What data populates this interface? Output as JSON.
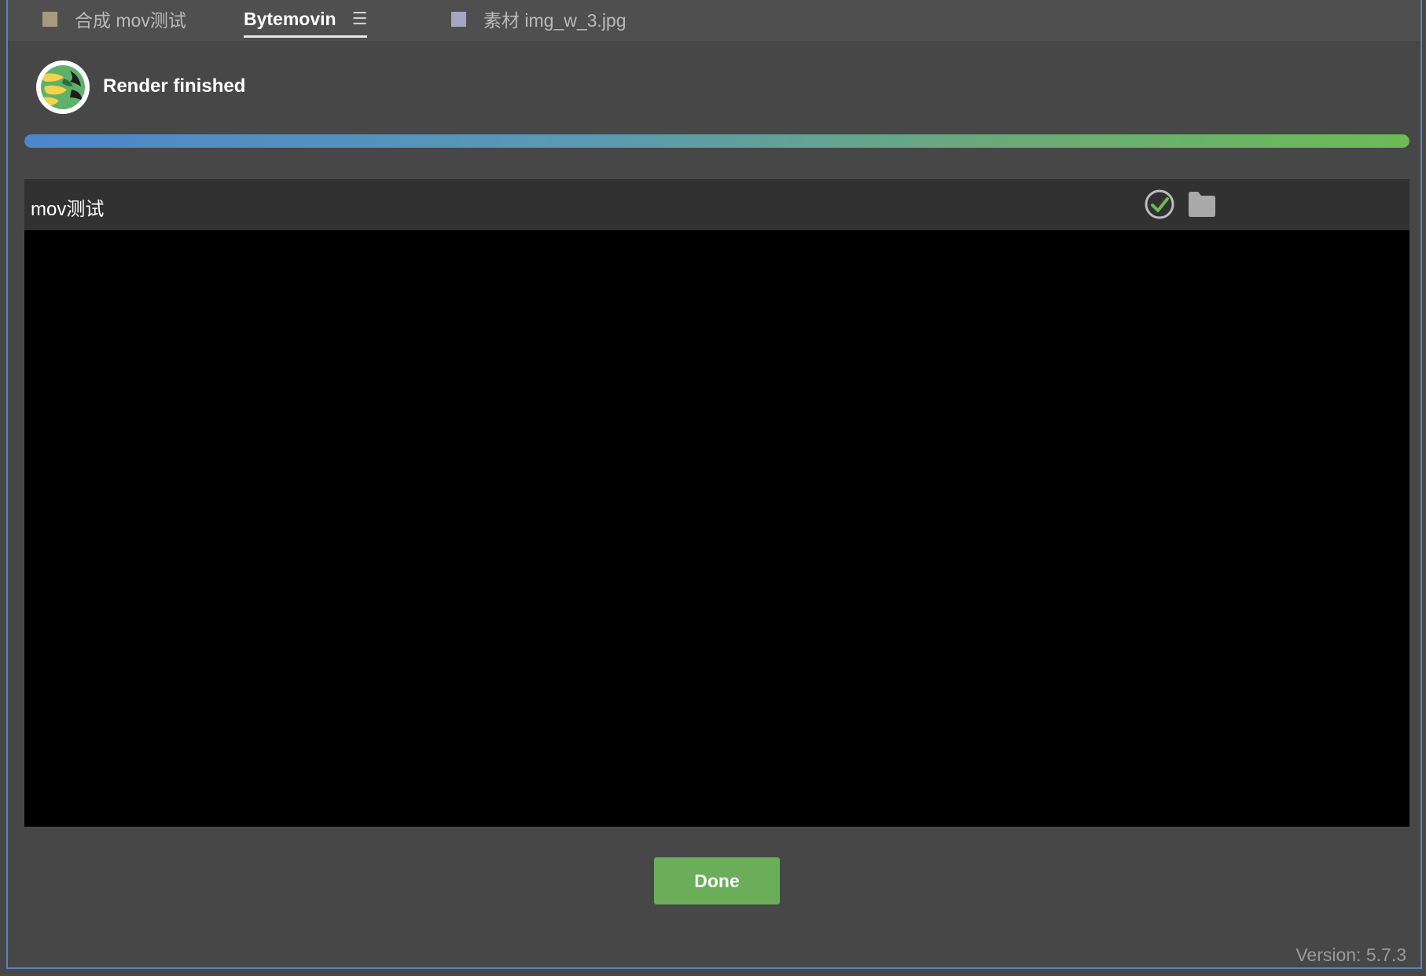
{
  "tabs": [
    {
      "label": "合成 mov测试",
      "swatch_color": "#a89a80"
    },
    {
      "label": "Bytemovin",
      "menu_icon": "hamburger-menu-icon"
    },
    {
      "label": "素材 img_w_3.jpg",
      "swatch_color": "#a6a6c4"
    }
  ],
  "status": {
    "title": "Render finished",
    "progress_percent": 100
  },
  "render_item": {
    "name": "mov测试",
    "status_icon": "check-circle-icon",
    "folder_icon": "folder-icon"
  },
  "actions": {
    "done_label": "Done"
  },
  "footer": {
    "version": "Version: 5.7.3"
  },
  "colors": {
    "background": "#474747",
    "tabbar": "#4f4f4f",
    "item_header": "#313131",
    "accent_green": "#6aae5a",
    "progress_start": "#4a88cc",
    "progress_end": "#6cbb55",
    "window_border": "#5b83bd"
  }
}
